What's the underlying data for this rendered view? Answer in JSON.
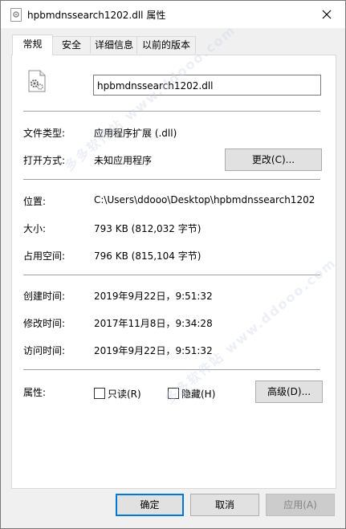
{
  "window": {
    "title": "hpbmdnssearch1202.dll 属性",
    "close_symbol": "✕"
  },
  "tabs": [
    {
      "label": "常规",
      "active": true
    },
    {
      "label": "安全",
      "active": false
    },
    {
      "label": "详细信息",
      "active": false
    },
    {
      "label": "以前的版本",
      "active": false
    }
  ],
  "general": {
    "filename": "hpbmdnssearch1202.dll",
    "file_type_label": "文件类型:",
    "file_type_value": "应用程序扩展 (.dll)",
    "opens_with_label": "打开方式:",
    "opens_with_value": "未知应用程序",
    "change_button": "更改(C)...",
    "location_label": "位置:",
    "location_value": "C:\\Users\\ddooo\\Desktop\\hpbmdnssearch1202",
    "size_label": "大小:",
    "size_value": "793 KB (812,032 字节)",
    "size_on_disk_label": "占用空间:",
    "size_on_disk_value": "796 KB (815,104 字节)",
    "created_label": "创建时间:",
    "created_value": "2019年9月22日，9:51:32",
    "modified_label": "修改时间:",
    "modified_value": "2017年11月8日，9:34:28",
    "accessed_label": "访问时间:",
    "accessed_value": "2019年9月22日，9:51:32",
    "attributes_label": "属性:",
    "readonly_label": "只读(R)",
    "readonly_checked": false,
    "hidden_label": "隐藏(H)",
    "hidden_checked": false,
    "advanced_button": "高级(D)..."
  },
  "footer": {
    "ok_button": "确定",
    "cancel_button": "取消",
    "apply_button": "应用(A)"
  },
  "watermark_text": "多多软件站  www.ddooo.com",
  "colors": {
    "default_button_border": "#0078d7",
    "disabled_text": "#838383"
  },
  "icons": {
    "title": "dll-file-icon",
    "file": "dll-gear-file-icon",
    "close": "close-icon"
  }
}
